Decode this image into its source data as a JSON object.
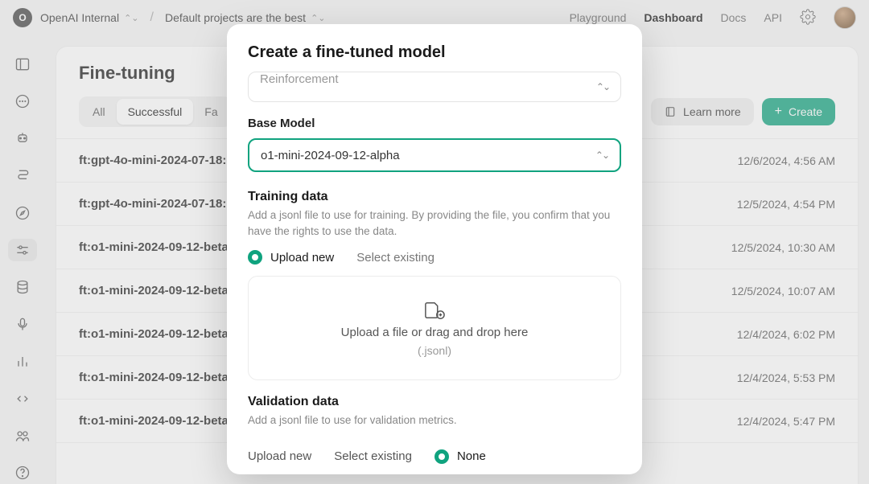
{
  "header": {
    "org_initial": "O",
    "org_name": "OpenAI Internal",
    "project_name": "Default projects are the best",
    "nav": {
      "playground": "Playground",
      "dashboard": "Dashboard",
      "docs": "Docs",
      "api": "API"
    }
  },
  "page": {
    "title": "Fine-tuning",
    "tabs": {
      "all": "All",
      "successful": "Successful",
      "failed_truncated": "Fa"
    },
    "learn_more": "Learn more",
    "create": "Create"
  },
  "jobs": [
    {
      "name": "ft:gpt-4o-mini-2024-07-18:",
      "date": "12/6/2024, 4:56 AM"
    },
    {
      "name": "ft:gpt-4o-mini-2024-07-18:",
      "date": "12/5/2024, 4:54 PM"
    },
    {
      "name": "ft:o1-mini-2024-09-12-beta:",
      "date": "12/5/2024, 10:30 AM"
    },
    {
      "name": "ft:o1-mini-2024-09-12-beta:",
      "date": "12/5/2024, 10:07 AM"
    },
    {
      "name": "ft:o1-mini-2024-09-12-beta:",
      "date": "12/4/2024, 6:02 PM"
    },
    {
      "name": "ft:o1-mini-2024-09-12-beta:",
      "date": "12/4/2024, 5:53 PM"
    },
    {
      "name": "ft:o1-mini-2024-09-12-beta:",
      "date": "12/4/2024, 5:47 PM"
    }
  ],
  "modal": {
    "title": "Create a fine-tuned model",
    "method_truncated": "Reinforcement",
    "base_model_label": "Base Model",
    "base_model_value": "o1-mini-2024-09-12-alpha",
    "training": {
      "title": "Training data",
      "desc": "Add a jsonl file to use for training. By providing the file, you confirm that you have the rights to use the data.",
      "upload_new": "Upload new",
      "select_existing": "Select existing",
      "drop_title": "Upload a file or drag and drop here",
      "drop_sub": "(.jsonl)"
    },
    "validation": {
      "title": "Validation data",
      "desc": "Add a jsonl file to use for validation metrics.",
      "upload_new": "Upload new",
      "select_existing": "Select existing",
      "none": "None"
    }
  }
}
